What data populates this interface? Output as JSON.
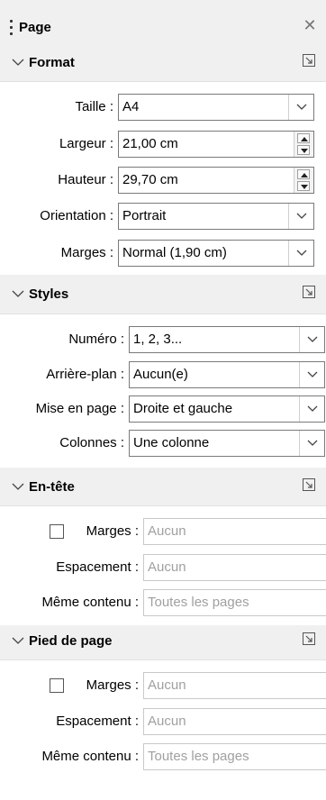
{
  "panel": {
    "title": "Page",
    "close_icon": "close-icon"
  },
  "format": {
    "heading": "Format",
    "size_label": "Taille :",
    "size_value": "A4",
    "width_label": "Largeur :",
    "width_value": "21,00 cm",
    "height_label": "Hauteur :",
    "height_value": "29,70 cm",
    "orientation_label": "Orientation :",
    "orientation_value": "Portrait",
    "margins_label": "Marges :",
    "margins_value": "Normal (1,90 cm)"
  },
  "styles": {
    "heading": "Styles",
    "number_label": "Numéro :",
    "number_value": "1, 2, 3...",
    "background_label": "Arrière-plan :",
    "background_value": "Aucun(e)",
    "layout_label": "Mise en page :",
    "layout_value": "Droite et gauche",
    "columns_label": "Colonnes :",
    "columns_value": "Une colonne"
  },
  "header": {
    "heading": "En-tête",
    "margins_label": "Marges :",
    "margins_value": "Aucun",
    "spacing_label": "Espacement :",
    "spacing_value": "Aucun",
    "same_label": "Même contenu :",
    "same_value": "Toutes les pages",
    "enabled": false
  },
  "footer": {
    "heading": "Pied de page",
    "margins_label": "Marges :",
    "margins_value": "Aucun",
    "spacing_label": "Espacement :",
    "spacing_value": "Aucun",
    "same_label": "Même contenu :",
    "same_value": "Toutes les pages",
    "enabled": false
  }
}
